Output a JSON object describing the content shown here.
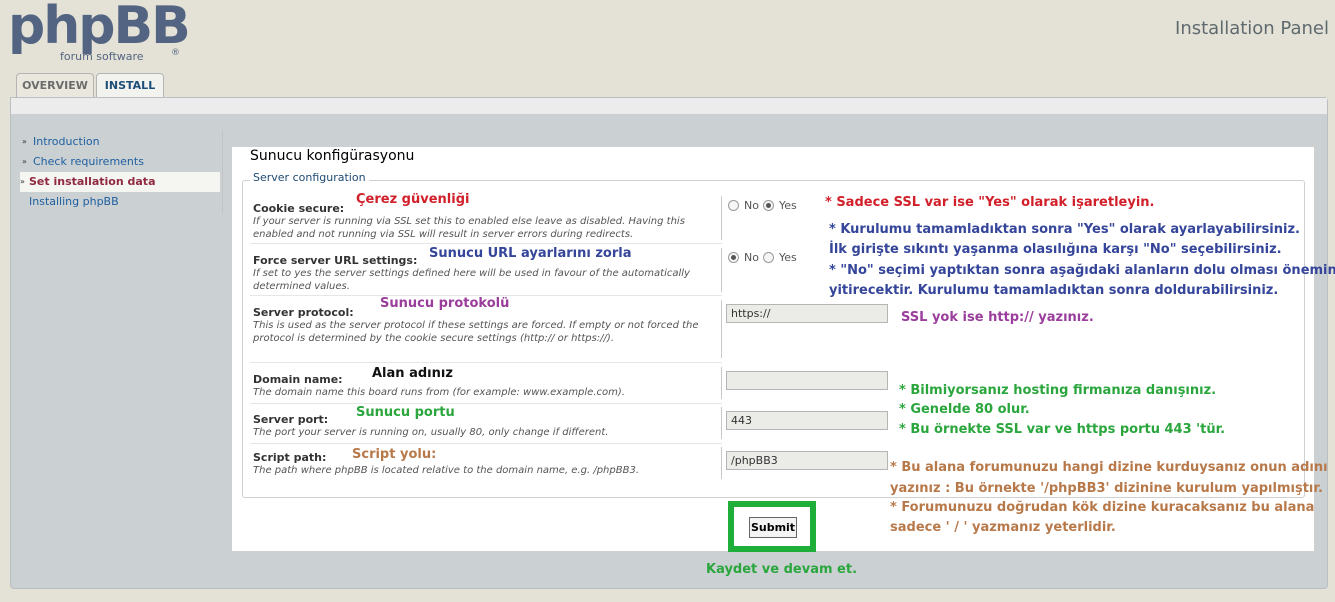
{
  "header": {
    "logo_text": "phpBB",
    "logo_sub": "forum software",
    "logo_reg": "®",
    "panel_title": "Installation Panel"
  },
  "tabs": [
    {
      "label": "OVERVIEW",
      "active": false
    },
    {
      "label": "INSTALL",
      "active": true
    }
  ],
  "sidebar": {
    "items": [
      {
        "label": "Introduction",
        "bullet": "»"
      },
      {
        "label": "Check requirements",
        "bullet": "»"
      },
      {
        "label": "Set installation data",
        "bullet": "»",
        "active": true
      },
      {
        "label": "Installing phpBB",
        "bullet": ""
      }
    ]
  },
  "content": {
    "page_title": "Sunucu konfigürasyonu",
    "legend": "Server configuration",
    "fields": {
      "cookie_secure": {
        "label": "Cookie secure:",
        "help": "If your server is running via SSL set this to enabled else leave as disabled. Having this enabled and not running via SSL will result in server errors during redirects.",
        "options": [
          "No",
          "Yes"
        ],
        "selected": "Yes"
      },
      "force_server_vars": {
        "label": "Force server URL settings:",
        "help": "If set to yes the server settings defined here will be used in favour of the automatically determined values.",
        "options": [
          "No",
          "Yes"
        ],
        "selected": "No"
      },
      "server_protocol": {
        "label": "Server protocol:",
        "help": "This is used as the server protocol if these settings are forced. If empty or not forced the protocol is determined by the cookie secure settings (http:// or https://).",
        "value": "https://"
      },
      "server_name": {
        "label": "Domain name:",
        "help": "The domain name this board runs from (for example: www.example.com).",
        "value": ""
      },
      "server_port": {
        "label": "Server port:",
        "help": "The port your server is running on, usually 80, only change if different.",
        "value": "443"
      },
      "script_path": {
        "label": "Script path:",
        "help": "The path where phpBB is located relative to the domain name, e.g. /phpBB3.",
        "value": "/phpBB3"
      }
    },
    "submit_label": "Submit"
  },
  "annotations": {
    "cerez": "Çerez güvenliği",
    "ssl_yes": "* Sadece SSL var ise \"Yes\" olarak işaretleyin.",
    "force_title": "Sunucu URL ayarlarını zorla",
    "force_note_1": "* Kurulumu tamamladıktan sonra \"Yes\" olarak ayarlayabilirsiniz.",
    "force_note_2": "İlk girişte sıkıntı yaşanma olasılığına karşı \"No\" seçebilirsiniz.",
    "force_note_3": "* \"No\" seçimi yaptıktan sonra aşağıdaki alanların dolu olması önemini",
    "force_note_4": "yitirecektir. Kurulumu tamamladıktan sonra doldurabilirsiniz.",
    "protocol_title": "Sunucu protokolü",
    "protocol_note": "SSL yok ise http:// yazınız.",
    "domain_title": "Alan adınız",
    "domain_note_1": "* Bilmiyorsanız hosting firmanıza danışınız.",
    "port_note_1": "* Genelde 80 olur.",
    "port_note_2": "* Bu örnekte SSL var ve https portu 443 'tür.",
    "port_title": "Sunucu portu",
    "script_title": "Script yolu:",
    "script_note_1": "* Bu alana forumunuzu hangi dizine kurduysanız onun adını",
    "script_note_2": "yazınız : Bu örnekte '/phpBB3' dizinine kurulum yapılmıştır.",
    "script_note_3": "* Forumunuzu doğrudan kök dizine kuracaksanız bu alana",
    "script_note_4": "sadece ' / ' yazmanız yeterlidir.",
    "submit_note": "Kaydet ve devam et."
  },
  "colors": {
    "annotation_red": "#d2202a",
    "annotation_navy": "#34459a",
    "annotation_purple": "#9a3d9c",
    "annotation_green": "#2aa63d",
    "annotation_tan": "#b8794a",
    "submit_highlight": "#1fae3a",
    "link": "#1f5fa0"
  }
}
